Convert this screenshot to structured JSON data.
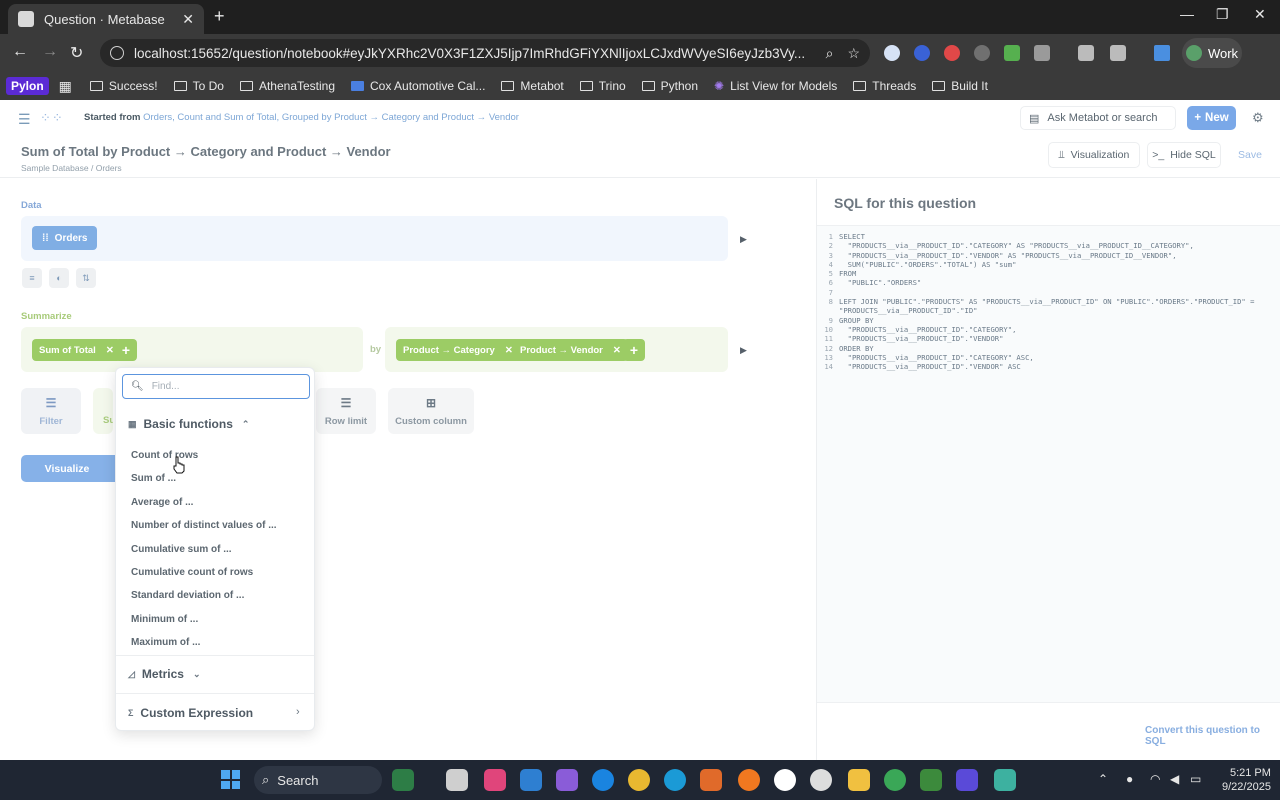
{
  "browser": {
    "tab_title": "Question · Metabase",
    "url_host": "localhost",
    "url_path": ":15652/question/notebook#eyJkYXRhc2V0X3F1ZXJ5Ijp7ImRhdGFiYXNlIjoxLCJ0eXBlIjoicXVlcnkiLCJxdWVyeSI6eyJzb3VyY2UtdGFibGUiOjJ9fQ...",
    "url_display": "localhost:15652/question/notebook#eyJkYXRhc2V0X3F1ZXJ5Ijp7ImRhdGFiYXNlIjoxLCJxdWVyeSI6eyJzb3Vy...",
    "profile_label": "Work"
  },
  "bookmarks": [
    {
      "label": "Pylon",
      "kind": "brand"
    },
    {
      "label": "Success!",
      "kind": "folder"
    },
    {
      "label": "To Do",
      "kind": "folder"
    },
    {
      "label": "AthenaTesting",
      "kind": "folder"
    },
    {
      "label": "Cox Automotive Cal...",
      "kind": "doc"
    },
    {
      "label": "Metabot",
      "kind": "folder"
    },
    {
      "label": "Trino",
      "kind": "folder"
    },
    {
      "label": "Python",
      "kind": "folder"
    },
    {
      "label": "List View for Models",
      "kind": "app"
    },
    {
      "label": "Threads",
      "kind": "folder"
    },
    {
      "label": "Build It",
      "kind": "folder"
    }
  ],
  "header": {
    "started_prefix": "Started from",
    "started_link": "Orders, Count and Sum of Total, Grouped by Product → Category and Product → Vendor",
    "ask_label": "Ask Metabot or search",
    "new_label": "New"
  },
  "question": {
    "title": "Sum of Total by Product → Category and Product → Vendor",
    "breadcrumb_db": "Sample Database",
    "breadcrumb_sep": "/",
    "breadcrumb_table": "Orders",
    "visualization_label": "Visualization",
    "hide_sql_label": "Hide SQL",
    "save_label": "Save"
  },
  "notebook": {
    "data_label": "Data",
    "data_table": "Orders",
    "summarize_label": "Summarize",
    "metric": "Sum of Total",
    "by_label": "by",
    "breakouts": [
      "Product → Category",
      "Product → Vendor"
    ],
    "steps": {
      "filter": "Filter",
      "summarize_partial": "Su",
      "row_limit": "Row limit",
      "custom_column": "Custom column"
    },
    "visualize_label": "Visualize"
  },
  "popover": {
    "search_placeholder": "Find...",
    "basic_functions_label": "Basic functions",
    "functions": [
      "Count of rows",
      "Sum of ...",
      "Average of ...",
      "Number of distinct values of ...",
      "Cumulative sum of ...",
      "Cumulative count of rows",
      "Standard deviation of ...",
      "Minimum of ...",
      "Maximum of ..."
    ],
    "metrics_label": "Metrics",
    "custom_expression_label": "Custom Expression"
  },
  "sql_panel": {
    "title": "SQL for this question",
    "lines": [
      {
        "n": "1",
        "code": "SELECT"
      },
      {
        "n": "2",
        "code": "  \"PRODUCTS__via__PRODUCT_ID\".\"CATEGORY\" AS \"PRODUCTS__via__PRODUCT_ID__CATEGORY\","
      },
      {
        "n": "3",
        "code": "  \"PRODUCTS__via__PRODUCT_ID\".\"VENDOR\" AS \"PRODUCTS__via__PRODUCT_ID__VENDOR\","
      },
      {
        "n": "4",
        "code": "  SUM(\"PUBLIC\".\"ORDERS\".\"TOTAL\") AS \"sum\""
      },
      {
        "n": "5",
        "code": "FROM"
      },
      {
        "n": "6",
        "code": "  \"PUBLIC\".\"ORDERS\""
      },
      {
        "n": "7",
        "code": ""
      },
      {
        "n": "8",
        "code": "LEFT JOIN \"PUBLIC\".\"PRODUCTS\" AS \"PRODUCTS__via__PRODUCT_ID\" ON \"PUBLIC\".\"ORDERS\".\"PRODUCT_ID\" ="
      },
      {
        "n": "",
        "code": "\"PRODUCTS__via__PRODUCT_ID\".\"ID\""
      },
      {
        "n": "9",
        "code": "GROUP BY"
      },
      {
        "n": "10",
        "code": "  \"PRODUCTS__via__PRODUCT_ID\".\"CATEGORY\","
      },
      {
        "n": "11",
        "code": "  \"PRODUCTS__via__PRODUCT_ID\".\"VENDOR\""
      },
      {
        "n": "12",
        "code": "ORDER BY"
      },
      {
        "n": "13",
        "code": "  \"PRODUCTS__via__PRODUCT_ID\".\"CATEGORY\" ASC,"
      },
      {
        "n": "14",
        "code": "  \"PRODUCTS__via__PRODUCT_ID\".\"VENDOR\" ASC"
      }
    ],
    "convert_label": "Convert this question to SQL"
  },
  "taskbar": {
    "search_label": "Search",
    "time": "5:21 PM",
    "date": "9/22/2025"
  },
  "colors": {
    "brand_blue": "#509ee3",
    "summarize_green": "#9ccc65",
    "chrome_dark": "#1f1f1f"
  }
}
